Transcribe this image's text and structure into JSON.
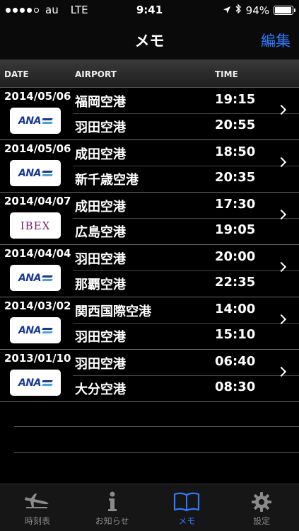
{
  "status": {
    "carrier": "au",
    "network": "LTE",
    "time": "9:41",
    "battery": "94%",
    "battery_level": 0.94
  },
  "nav": {
    "title": "メモ",
    "edit_label": "編集"
  },
  "columns": {
    "date": "DATE",
    "airport": "AIRPORT",
    "time": "TIME"
  },
  "flights": [
    {
      "date": "2014/05/06",
      "airline": "ANA",
      "from": "福岡空港",
      "to": "羽田空港",
      "dep": "19:15",
      "arr": "20:55"
    },
    {
      "date": "2014/05/06",
      "airline": "ANA",
      "from": "成田空港",
      "to": "新千歳空港",
      "dep": "18:50",
      "arr": "20:35"
    },
    {
      "date": "2014/04/07",
      "airline": "IBEX",
      "from": "成田空港",
      "to": "広島空港",
      "dep": "17:30",
      "arr": "19:05"
    },
    {
      "date": "2014/04/04",
      "airline": "ANA",
      "from": "羽田空港",
      "to": "那覇空港",
      "dep": "20:00",
      "arr": "22:35"
    },
    {
      "date": "2014/03/02",
      "airline": "ANA",
      "from": "関西国際空港",
      "to": "羽田空港",
      "dep": "14:00",
      "arr": "15:10"
    },
    {
      "date": "2013/01/10",
      "airline": "ANA",
      "from": "羽田空港",
      "to": "大分空港",
      "dep": "06:40",
      "arr": "08:30"
    }
  ],
  "tabs": [
    {
      "label": "時刻表",
      "icon": "airplane-icon"
    },
    {
      "label": "お知らせ",
      "icon": "info-icon"
    },
    {
      "label": "メモ",
      "icon": "book-icon"
    },
    {
      "label": "設定",
      "icon": "gear-icon"
    }
  ],
  "colors": {
    "accent": "#2f7bff",
    "tab_inactive": "#8a8a8a"
  }
}
